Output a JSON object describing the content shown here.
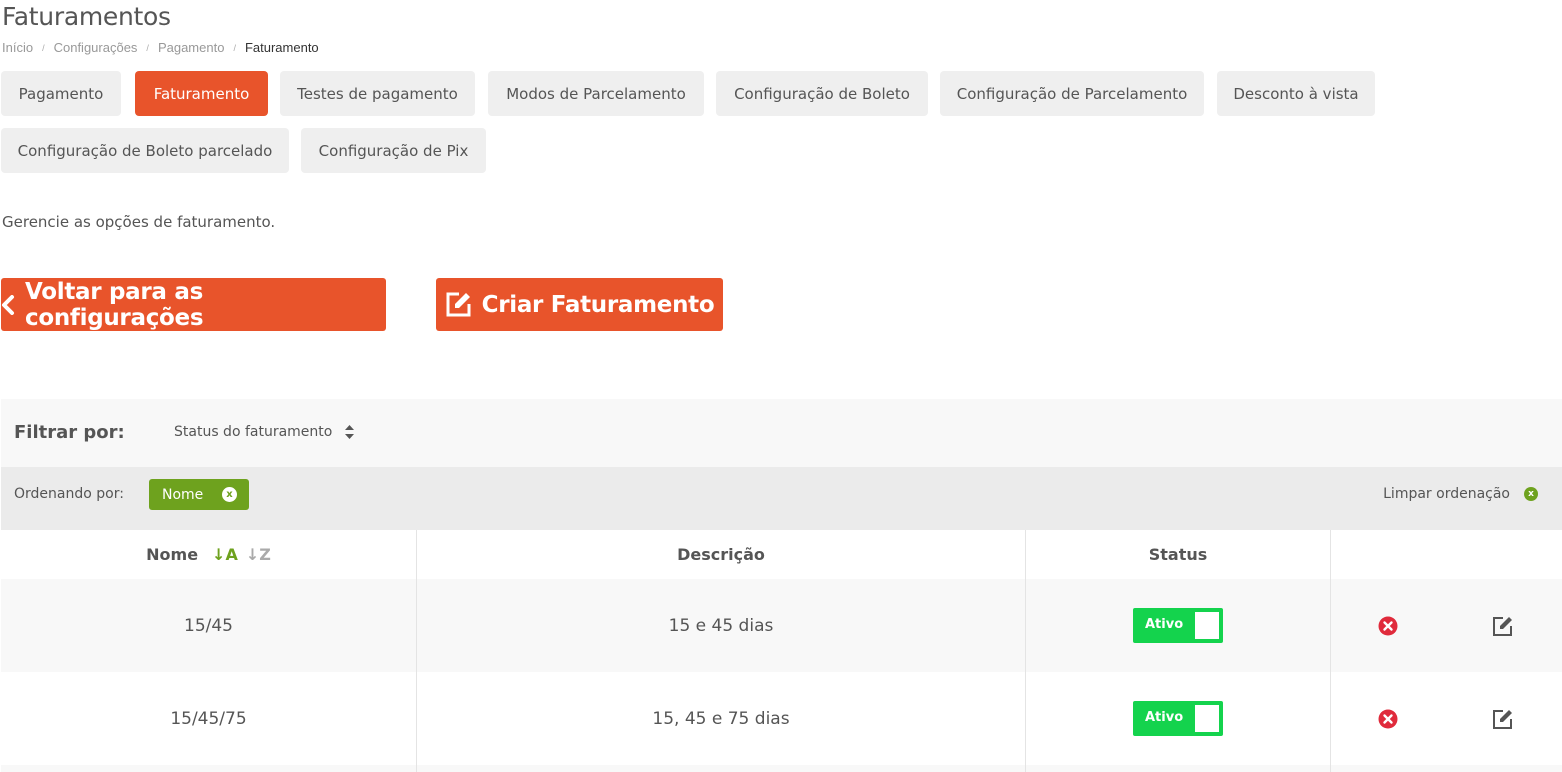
{
  "page": {
    "title": "Faturamentos",
    "description": "Gerencie as opções de faturamento."
  },
  "breadcrumb": {
    "items": [
      "Início",
      "Configurações",
      "Pagamento"
    ],
    "current": "Faturamento"
  },
  "tabs": [
    "Pagamento",
    "Faturamento",
    "Testes de pagamento",
    "Modos de Parcelamento",
    "Configuração de Boleto",
    "Configuração de Parcelamento",
    "Desconto à vista",
    "Configuração de Boleto parcelado",
    "Configuração de Pix"
  ],
  "active_tab": "Faturamento",
  "buttons": {
    "back": "Voltar para as configurações",
    "create": "Criar Faturamento"
  },
  "filter": {
    "label": "Filtrar por:",
    "select_value": "Status do faturamento"
  },
  "sort": {
    "label": "Ordenando por:",
    "chip": "Nome",
    "chip_close": "x",
    "clear": "Limpar ordenação",
    "clear_close": "x"
  },
  "table": {
    "headers": [
      "Nome",
      "Descrição",
      "Status",
      ""
    ],
    "sort_asc": "↓A",
    "sort_desc": "↓Z",
    "rows": [
      {
        "nome": "15/45",
        "descricao": "15 e 45 dias",
        "status": "Ativo",
        "delete": "x"
      },
      {
        "nome": "15/45/75",
        "descricao": "15, 45 e 75 dias",
        "status": "Ativo",
        "delete": "x"
      }
    ]
  },
  "colors": {
    "accent": "#e8542b",
    "sort_green": "#6ea21e",
    "toggle_green": "#14d34d",
    "delete_red": "#e02b3c"
  }
}
